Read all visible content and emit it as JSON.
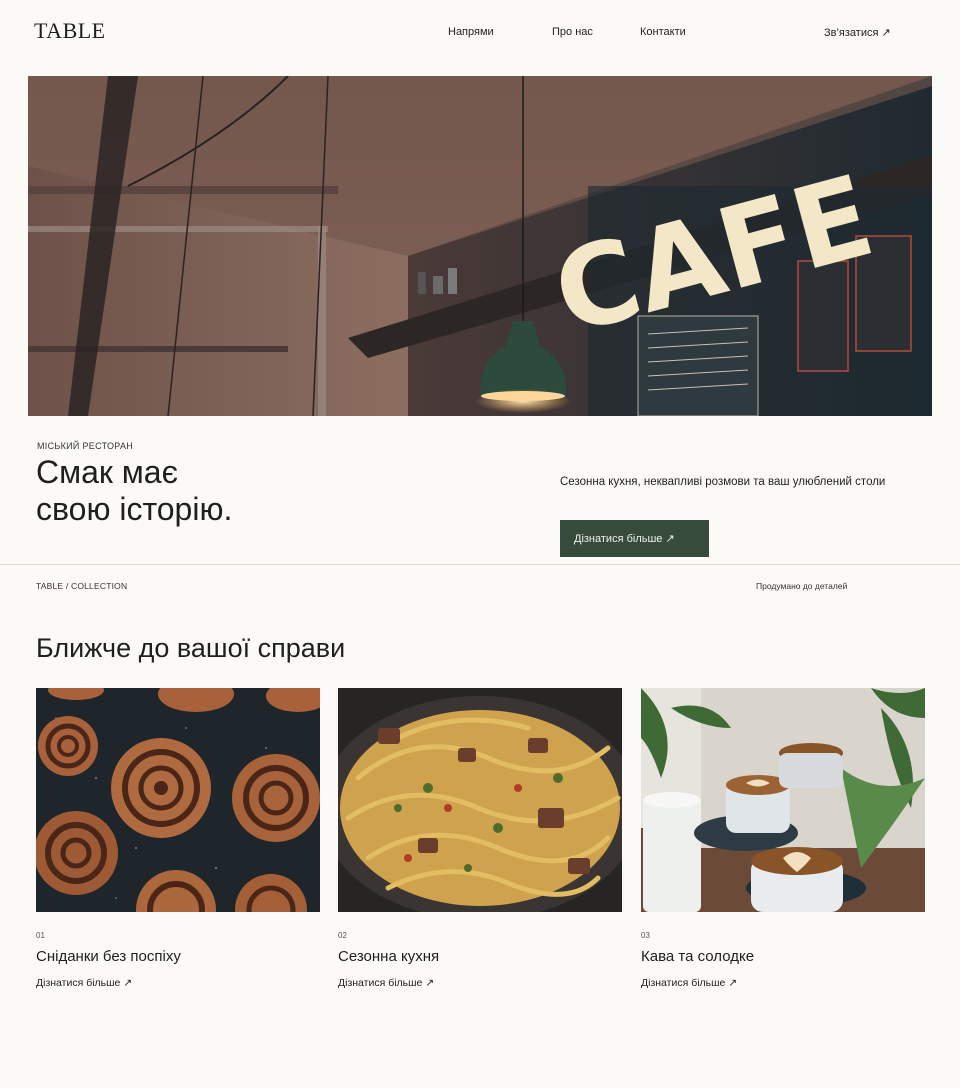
{
  "header": {
    "logo": "TABLE",
    "nav": [
      "Напрями",
      "Про нас",
      "Контакти"
    ],
    "contact": "Зв’язатися ↗"
  },
  "hero": {
    "sign_text": "CAFE"
  },
  "intro": {
    "eyebrow": "МІСЬКИЙ РЕСТОРАН",
    "headline_line1": "Смак має",
    "headline_line2": "свою історію.",
    "tagline": "Сезонна кухня, неквапливі розмови та ваш улюблений столи",
    "cta": "Дізнатися більше ↗"
  },
  "strip": {
    "left": "TABLE / COLLECTION",
    "right": "Продумано до деталей"
  },
  "section": {
    "title": "Ближче до вашої справи"
  },
  "cards": [
    {
      "num": "01",
      "title": "Сніданки без поспіху",
      "link": "Дізнатися більше ↗"
    },
    {
      "num": "02",
      "title": "Сезонна кухня",
      "link": "Дізнатися більше ↗"
    },
    {
      "num": "03",
      "title": "Кава та солодке",
      "link": "Дізнатися більше ↗"
    }
  ],
  "colors": {
    "background": "#fbfaf6",
    "cta": "#374b3c",
    "text": "#1f1f1f"
  }
}
